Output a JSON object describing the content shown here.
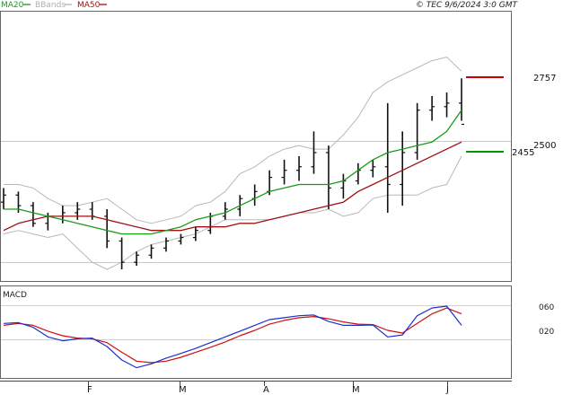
{
  "header": {
    "legend": [
      {
        "label": "MA20",
        "color": "#1a9a1a"
      },
      {
        "label": "BBands",
        "color": "#b0b0b0"
      },
      {
        "label": "MA50",
        "color": "#a01010"
      }
    ],
    "copyright": "© TEC 9/6/2024 3:0 GMT"
  },
  "chart_data": [
    {
      "type": "line",
      "title": "",
      "x_ticks": [
        "F",
        "M",
        "A",
        "M",
        "J"
      ],
      "y_ticks": [
        2500
      ],
      "level_labels": [
        {
          "text": "2757",
          "value": 27.57,
          "color": "#cc0000"
        },
        {
          "text": "2455",
          "value": 24.55,
          "color": "#009900"
        }
      ],
      "ylim": [
        22.6,
        29.2
      ],
      "series": [
        {
          "name": "MA20",
          "color": "#1a9a1a",
          "values": [
            24.3,
            24.3,
            24.2,
            24.1,
            24.0,
            23.9,
            23.8,
            23.7,
            23.6,
            23.6,
            23.6,
            23.7,
            23.8,
            24.0,
            24.1,
            24.2,
            24.4,
            24.6,
            24.8,
            24.9,
            25.0,
            25.0,
            25.0,
            25.1,
            25.4,
            25.7,
            25.9,
            26.0,
            26.1,
            26.2,
            26.5,
            27.1
          ]
        },
        {
          "name": "MA50",
          "color": "#a01010",
          "values": [
            23.7,
            23.9,
            24.0,
            24.1,
            24.1,
            24.1,
            24.1,
            24.0,
            23.9,
            23.8,
            23.7,
            23.7,
            23.7,
            23.8,
            23.8,
            23.8,
            23.9,
            23.9,
            24.0,
            24.1,
            24.2,
            24.3,
            24.4,
            24.5,
            24.8,
            25.0,
            25.2,
            25.4,
            25.6,
            25.8,
            26.0,
            26.2
          ]
        }
      ],
      "bands": {
        "name": "BBands",
        "color": "#b8b8b8",
        "upper": [
          25.0,
          25.0,
          24.9,
          24.6,
          24.4,
          24.4,
          24.5,
          24.6,
          24.3,
          24.0,
          23.9,
          24.0,
          24.1,
          24.4,
          24.5,
          24.8,
          25.3,
          25.5,
          25.8,
          26.0,
          26.1,
          26.0,
          26.0,
          26.4,
          26.9,
          27.6,
          27.9,
          28.1,
          28.3,
          28.5,
          28.6,
          28.2
        ],
        "lower": [
          23.6,
          23.7,
          23.6,
          23.5,
          23.6,
          23.2,
          22.8,
          22.6,
          22.8,
          23.1,
          23.3,
          23.4,
          23.5,
          23.6,
          23.8,
          24.0,
          24.0,
          24.0,
          24.0,
          24.1,
          24.2,
          24.2,
          24.3,
          24.1,
          24.2,
          24.6,
          24.7,
          24.7,
          24.7,
          24.9,
          25.0,
          25.8
        ]
      },
      "ohlc": [
        [
          24.5,
          24.9,
          24.3,
          24.7
        ],
        [
          24.7,
          24.8,
          24.2,
          24.4
        ],
        [
          24.4,
          24.5,
          23.8,
          23.9
        ],
        [
          23.9,
          24.2,
          23.7,
          24.1
        ],
        [
          24.1,
          24.4,
          23.9,
          24.2
        ],
        [
          24.2,
          24.5,
          24.0,
          24.3
        ],
        [
          24.3,
          24.5,
          24.0,
          24.1
        ],
        [
          24.1,
          24.3,
          23.2,
          23.4
        ],
        [
          23.4,
          23.5,
          22.6,
          22.8
        ],
        [
          22.8,
          23.1,
          22.7,
          23.0
        ],
        [
          23.0,
          23.3,
          22.9,
          23.2
        ],
        [
          23.2,
          23.5,
          23.1,
          23.4
        ],
        [
          23.4,
          23.6,
          23.3,
          23.5
        ],
        [
          23.5,
          23.8,
          23.4,
          23.7
        ],
        [
          23.7,
          24.2,
          23.6,
          24.1
        ],
        [
          24.1,
          24.5,
          24.0,
          24.3
        ],
        [
          24.3,
          24.7,
          24.1,
          24.6
        ],
        [
          24.6,
          25.0,
          24.4,
          24.8
        ],
        [
          24.8,
          25.4,
          24.7,
          25.2
        ],
        [
          25.2,
          25.7,
          25.0,
          25.4
        ],
        [
          25.4,
          25.8,
          25.1,
          25.5
        ],
        [
          25.5,
          26.5,
          25.3,
          25.9
        ],
        [
          25.9,
          26.1,
          24.3,
          24.9
        ],
        [
          24.9,
          25.3,
          24.6,
          25.1
        ],
        [
          25.1,
          25.6,
          25.0,
          25.4
        ],
        [
          25.4,
          25.7,
          25.2,
          25.5
        ],
        [
          25.5,
          27.3,
          24.2,
          25.0
        ],
        [
          25.0,
          26.5,
          24.4,
          25.9
        ],
        [
          25.9,
          27.3,
          25.7,
          27.1
        ],
        [
          27.1,
          27.5,
          26.8,
          27.2
        ],
        [
          27.2,
          27.6,
          26.9,
          27.3
        ],
        [
          27.3,
          28.0,
          26.8,
          26.7
        ]
      ],
      "ohlc_order": [
        "open",
        "high",
        "low",
        "close"
      ]
    },
    {
      "type": "line",
      "title": "MACD",
      "y_ticks": [
        "060",
        "020"
      ],
      "ylim": [
        -0.9,
        1.2
      ],
      "series": [
        {
          "name": "MACD",
          "color": "#1c2fd0",
          "values": [
            0.4,
            0.42,
            0.3,
            0.05,
            -0.05,
            0.0,
            0.02,
            -0.2,
            -0.55,
            -0.75,
            -0.65,
            -0.5,
            -0.38,
            -0.25,
            -0.1,
            0.05,
            0.2,
            0.35,
            0.5,
            0.55,
            0.6,
            0.62,
            0.45,
            0.35,
            0.35,
            0.36,
            0.05,
            0.1,
            0.6,
            0.8,
            0.85,
            0.35
          ]
        },
        {
          "name": "Signal",
          "color": "#cc1111",
          "values": [
            0.35,
            0.4,
            0.35,
            0.2,
            0.08,
            0.02,
            0.0,
            -0.1,
            -0.35,
            -0.58,
            -0.62,
            -0.58,
            -0.48,
            -0.35,
            -0.22,
            -0.08,
            0.08,
            0.22,
            0.38,
            0.48,
            0.55,
            0.58,
            0.52,
            0.44,
            0.38,
            0.37,
            0.22,
            0.15,
            0.4,
            0.65,
            0.8,
            0.65
          ]
        }
      ]
    }
  ]
}
